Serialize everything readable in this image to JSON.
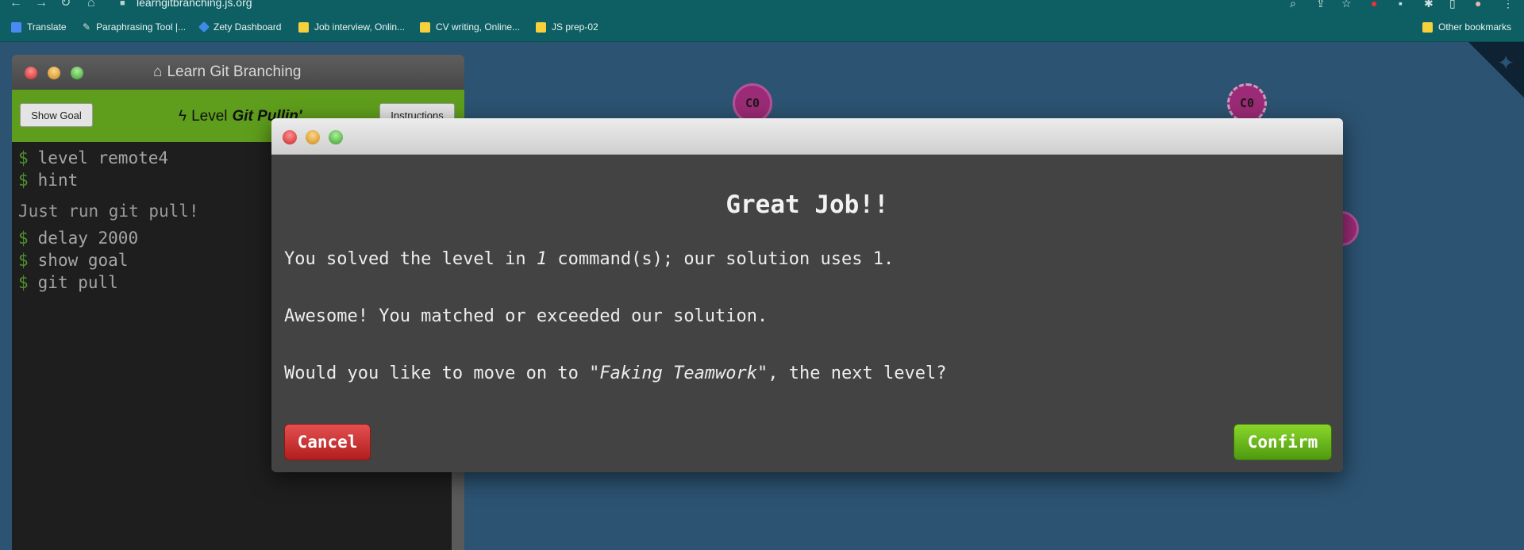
{
  "browser": {
    "url": "learngitbranching.js.org",
    "bookmarks": [
      {
        "label": "Translate",
        "icon": "google-translate-icon",
        "color": "#4a8af4"
      },
      {
        "label": "Paraphrasing Tool |...",
        "icon": "pen-icon",
        "color": "#dddddd"
      },
      {
        "label": "Zety Dashboard",
        "icon": "zety-icon",
        "color": "#3d8be8"
      },
      {
        "label": "Job interview, Onlin...",
        "icon": "miro-icon",
        "color": "#f6d13c"
      },
      {
        "label": "CV writing, Online...",
        "icon": "miro-icon",
        "color": "#f6d13c"
      },
      {
        "label": "JS prep-02",
        "icon": "folder-icon",
        "color": "#f6d13c"
      }
    ],
    "other_bookmarks": "Other bookmarks"
  },
  "graph": {
    "nodes": [
      {
        "label": "C0",
        "style": "solid"
      },
      {
        "label": "C0",
        "style": "dashed"
      }
    ]
  },
  "terminal": {
    "title": "Learn Git Branching",
    "show_goal": "Show Goal",
    "level_prefix": "Level",
    "level_name": "Git Pullin'",
    "instructions": "Instructions",
    "prompt": "$",
    "commands_1": [
      "level remote4",
      "hint"
    ],
    "hint_text": "Just run git pull!",
    "commands_2": [
      "delay 2000",
      "show goal",
      "git pull"
    ]
  },
  "modal": {
    "heading": "Great Job!!",
    "line1_pre": "You solved the level in ",
    "line1_count": "1",
    "line1_post": " command(s); our solution uses 1.",
    "line2": "Awesome! You matched or exceeded our solution.",
    "line3_pre": "Would you like to move on to \"",
    "line3_level": "Faking Teamwork",
    "line3_post": "\", the next level?",
    "cancel": "Cancel",
    "confirm": "Confirm"
  }
}
